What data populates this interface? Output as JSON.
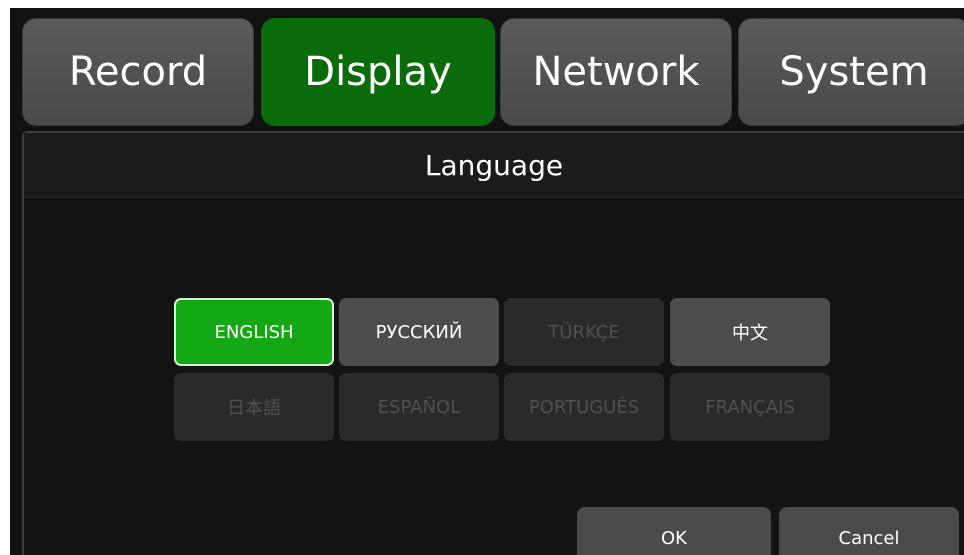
{
  "tabs": [
    {
      "label": "Record",
      "active": false
    },
    {
      "label": "Display",
      "active": true
    },
    {
      "label": "Network",
      "active": false
    },
    {
      "label": "System",
      "active": false
    }
  ],
  "dialog": {
    "title": "Language",
    "languages": [
      {
        "label": "ENGLISH",
        "state": "selected"
      },
      {
        "label": "РУССКИЙ",
        "state": "enabled"
      },
      {
        "label": "TÜRKÇE",
        "state": "disabled"
      },
      {
        "label": "中文",
        "state": "enabled"
      },
      {
        "label": "日本語",
        "state": "disabled"
      },
      {
        "label": "ESPAÑOL",
        "state": "disabled"
      },
      {
        "label": "PORTUGUÊS",
        "state": "disabled"
      },
      {
        "label": "FRANÇAIS",
        "state": "disabled"
      }
    ],
    "ok_label": "OK",
    "cancel_label": "Cancel"
  },
  "colors": {
    "active_tab": "#0a6b0a",
    "selected_language": "#15a815",
    "button": "#4a4a4a",
    "background": "#111111"
  }
}
